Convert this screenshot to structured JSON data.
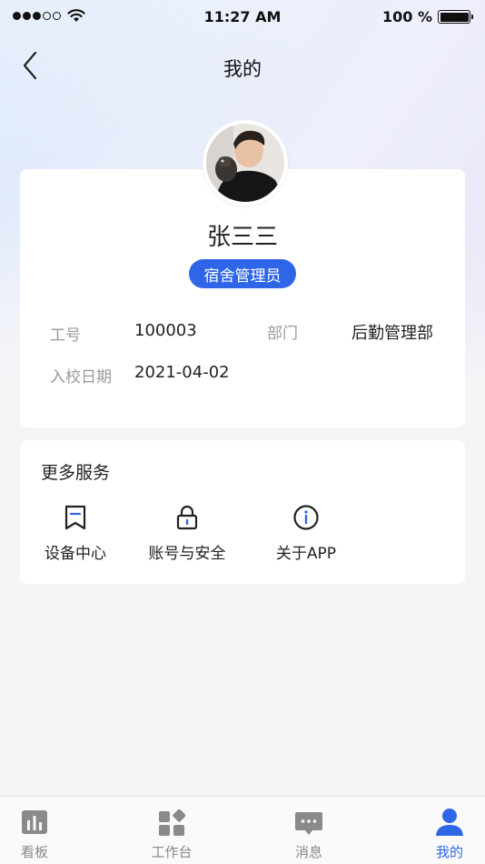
{
  "status_bar": {
    "time": "11:27 AM",
    "battery": "100 %"
  },
  "nav": {
    "title": "我的"
  },
  "profile": {
    "name": "张三三",
    "role": "宿舍管理员",
    "fields": {
      "id_label": "工号",
      "id_value": "100003",
      "dept_label": "部门",
      "dept_value": "后勤管理部",
      "date_label": "入校日期",
      "date_value": "2021-04-02"
    }
  },
  "services": {
    "title": "更多服务",
    "items": [
      {
        "label": "设备中心",
        "icon": "bookmark-icon"
      },
      {
        "label": "账号与安全",
        "icon": "lock-icon"
      },
      {
        "label": "关于APP",
        "icon": "info-icon"
      }
    ]
  },
  "tabs": [
    {
      "label": "看板",
      "icon": "chart-icon",
      "active": false
    },
    {
      "label": "工作台",
      "icon": "grid-icon",
      "active": false
    },
    {
      "label": "消息",
      "icon": "message-icon",
      "active": false
    },
    {
      "label": "我的",
      "icon": "user-icon",
      "active": true
    }
  ],
  "colors": {
    "accent": "#2f66e8",
    "inactive": "#888888"
  }
}
